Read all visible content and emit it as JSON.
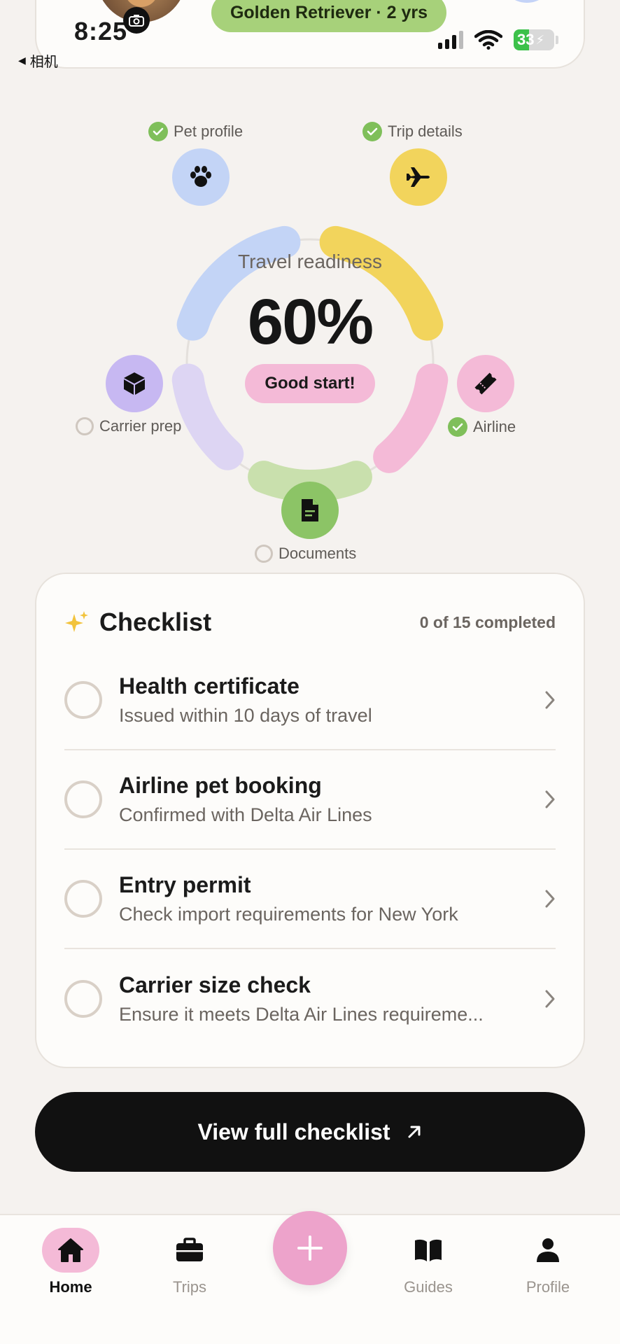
{
  "status_bar": {
    "time": "8:25",
    "back_label": "相机",
    "battery": "33"
  },
  "header": {
    "breed_pill": "Golden Retriever · 2 yrs"
  },
  "readiness": {
    "title": "Travel readiness",
    "percent": "60%",
    "badge": "Good start!",
    "value": 0.6,
    "colors": {
      "pet_profile": "#c3d4f6",
      "trip_details": "#f2d45c",
      "airline": "#f4bad7",
      "documents": "#c9e0ad",
      "carrier_prep": "#ddd5f3"
    },
    "nodes": [
      {
        "key": "pet_profile",
        "label": "Pet profile",
        "done": true,
        "icon": "paw-icon"
      },
      {
        "key": "trip_details",
        "label": "Trip details",
        "done": true,
        "icon": "airplane-icon"
      },
      {
        "key": "airline",
        "label": "Airline",
        "done": true,
        "icon": "ticket-icon"
      },
      {
        "key": "documents",
        "label": "Documents",
        "done": false,
        "icon": "document-icon"
      },
      {
        "key": "carrier_prep",
        "label": "Carrier prep",
        "done": false,
        "icon": "box-icon"
      }
    ]
  },
  "checklist": {
    "title": "Checklist",
    "count": "0 of 15 completed",
    "items": [
      {
        "title": "Health certificate",
        "subtitle": "Issued within 10 days of travel"
      },
      {
        "title": "Airline pet booking",
        "subtitle": "Confirmed with Delta Air Lines"
      },
      {
        "title": "Entry permit",
        "subtitle": "Check import requirements for New York"
      },
      {
        "title": "Carrier size check",
        "subtitle": "Ensure it meets Delta Air Lines requireme..."
      }
    ],
    "button_label": "View full checklist"
  },
  "nav": {
    "items": [
      {
        "label": "Home",
        "active": true
      },
      {
        "label": "Trips",
        "active": false
      },
      {
        "label": "Guides",
        "active": false
      },
      {
        "label": "Profile",
        "active": false
      }
    ]
  }
}
